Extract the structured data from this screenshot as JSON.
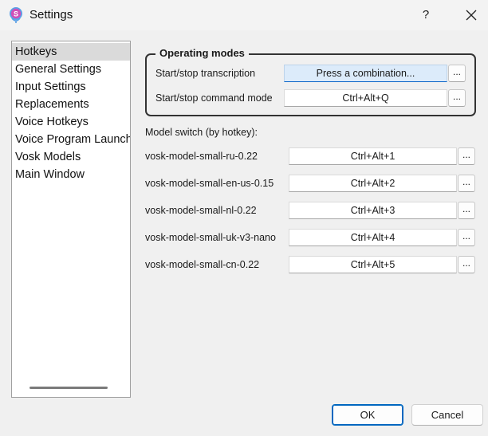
{
  "window": {
    "title": "Settings",
    "help_label": "?"
  },
  "sidebar": {
    "items": [
      {
        "label": "Hotkeys",
        "selected": true
      },
      {
        "label": "General Settings",
        "selected": false
      },
      {
        "label": "Input Settings",
        "selected": false
      },
      {
        "label": "Replacements",
        "selected": false
      },
      {
        "label": "Voice Hotkeys",
        "selected": false
      },
      {
        "label": "Voice Program Launch",
        "selected": false
      },
      {
        "label": "Vosk Models",
        "selected": false
      },
      {
        "label": "Main Window",
        "selected": false
      }
    ]
  },
  "operating_modes": {
    "title": "Operating modes",
    "transcription": {
      "label": "Start/stop transcription",
      "value": "Press a combination..."
    },
    "command_mode": {
      "label": "Start/stop command mode",
      "value": "Ctrl+Alt+Q"
    }
  },
  "model_switch": {
    "title": "Model switch (by hotkey):",
    "models": [
      {
        "name": "vosk-model-small-ru-0.22",
        "hotkey": "Ctrl+Alt+1"
      },
      {
        "name": "vosk-model-small-en-us-0.15",
        "hotkey": "Ctrl+Alt+2"
      },
      {
        "name": "vosk-model-small-nl-0.22",
        "hotkey": "Ctrl+Alt+3"
      },
      {
        "name": "vosk-model-small-uk-v3-nano",
        "hotkey": "Ctrl+Alt+4"
      },
      {
        "name": "vosk-model-small-cn-0.22",
        "hotkey": "Ctrl+Alt+5"
      }
    ]
  },
  "browse_label": "...",
  "buttons": {
    "ok": "OK",
    "cancel": "Cancel"
  },
  "icons": {
    "app": "microphone-s-icon",
    "close": "close-icon"
  },
  "colors": {
    "accent": "#0067c0",
    "active_field": "#dcebfa",
    "selected_item": "#dadada"
  }
}
